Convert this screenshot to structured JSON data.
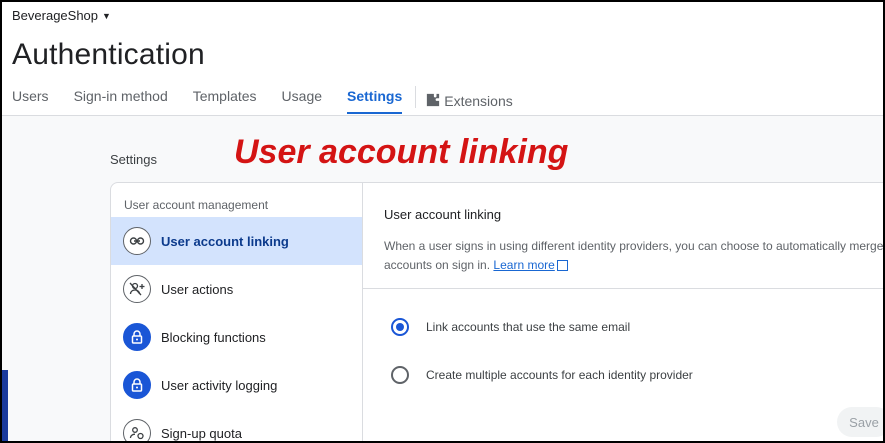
{
  "header": {
    "project_name": "BeverageShop",
    "page_title": "Authentication"
  },
  "tabs": [
    {
      "label": "Users"
    },
    {
      "label": "Sign-in method"
    },
    {
      "label": "Templates"
    },
    {
      "label": "Usage"
    },
    {
      "label": "Settings",
      "active": true
    },
    {
      "label": "Extensions",
      "icon": "extensions-icon"
    }
  ],
  "settings_heading": "Settings",
  "overlay_title": "User account linking",
  "side_nav": {
    "section_label": "User account management",
    "items": [
      {
        "label": "User account linking",
        "icon": "link-icon",
        "active": true
      },
      {
        "label": "User actions",
        "icon": "user-actions-icon"
      },
      {
        "label": "Blocking functions",
        "icon": "lock-icon"
      },
      {
        "label": "User activity logging",
        "icon": "lock-icon"
      },
      {
        "label": "Sign-up quota",
        "icon": "sign-up-quota-icon"
      }
    ]
  },
  "main": {
    "title": "User account linking",
    "description": "When a user signs in using different identity providers, you can choose to automatically merge accounts on sign in.",
    "learn_more": "Learn more",
    "options": [
      {
        "label": "Link accounts that use the same email",
        "selected": true
      },
      {
        "label": "Create multiple accounts for each identity provider",
        "selected": false
      }
    ],
    "save_label": "Save"
  },
  "colors": {
    "accent": "#1967d2",
    "overlay_red": "#d41414",
    "active_nav_bg": "#d3e3fd",
    "solid_icon_bg": "#1a56d6"
  }
}
